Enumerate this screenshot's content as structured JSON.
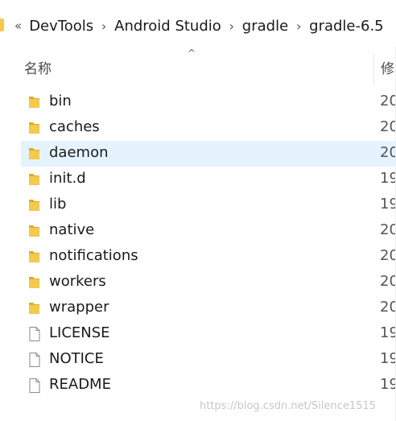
{
  "address_bar": {
    "overflow_glyph": "«",
    "crumbs": [
      "DevTools",
      "Android Studio",
      "gradle",
      "gradle-6.5"
    ],
    "separator_glyph": "›"
  },
  "columns": {
    "sort_glyph": "^",
    "name_label": "名称",
    "date_label": "修"
  },
  "files": [
    {
      "name": "bin",
      "type": "folder",
      "date": "20"
    },
    {
      "name": "caches",
      "type": "folder",
      "date": "20"
    },
    {
      "name": "daemon",
      "type": "folder",
      "date": "20",
      "selected": true
    },
    {
      "name": "init.d",
      "type": "folder",
      "date": "19"
    },
    {
      "name": "lib",
      "type": "folder",
      "date": "19"
    },
    {
      "name": "native",
      "type": "folder",
      "date": "20"
    },
    {
      "name": "notifications",
      "type": "folder",
      "date": "20"
    },
    {
      "name": "workers",
      "type": "folder",
      "date": "20"
    },
    {
      "name": "wrapper",
      "type": "folder",
      "date": "20"
    },
    {
      "name": "LICENSE",
      "type": "file",
      "date": "19"
    },
    {
      "name": "NOTICE",
      "type": "file",
      "date": "19"
    },
    {
      "name": "README",
      "type": "file",
      "date": "19"
    }
  ],
  "watermark": "https://blog.csdn.net/Silence1515",
  "colors": {
    "folder": "#f3c94e",
    "folder_dark": "#dfa92a",
    "selected_row": "#e5f3ff"
  }
}
